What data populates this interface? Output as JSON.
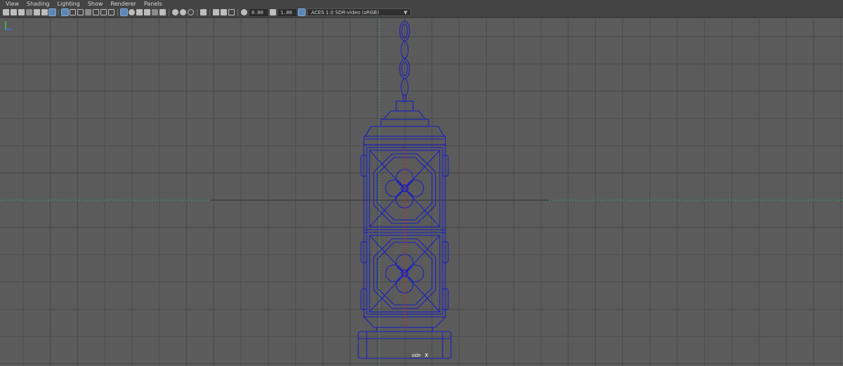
{
  "menubar": {
    "items": [
      "View",
      "Shading",
      "Lighting",
      "Show",
      "Renderer",
      "Panels"
    ]
  },
  "toolbar": {
    "exposure_value": "0.00",
    "gamma_value": "1.00",
    "color_management": "ACES 1.0 SDR-video (sRGB)",
    "icons": [
      "camera-icon",
      "bookmark-icon",
      "grid-icon",
      "wireframe-icon",
      "smooth-shade-icon",
      "texture-icon",
      "lighting-icon",
      "shadow-icon",
      "isolate-icon",
      "xray-icon"
    ]
  },
  "viewport": {
    "camera_name": "side",
    "camera_axis": "X",
    "background_color": "#5b5b5b",
    "grid_color": "#4a4a4a",
    "wireframe_color": "#1a1fbf"
  }
}
